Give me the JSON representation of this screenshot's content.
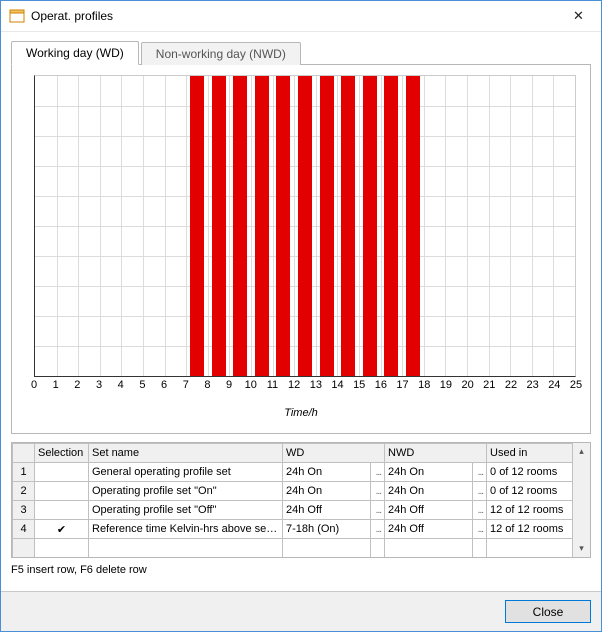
{
  "window": {
    "title": "Operat. profiles",
    "close_glyph": "✕"
  },
  "tabs": {
    "wd": "Working day (WD)",
    "nwd": "Non-working day (NWD)"
  },
  "chart_data": {
    "type": "bar",
    "title": "",
    "xlabel": "Time/h",
    "ylabel": "",
    "xlim": [
      0,
      25
    ],
    "ylim": [
      0,
      1
    ],
    "ticks": [
      0,
      1,
      2,
      3,
      4,
      5,
      6,
      7,
      8,
      9,
      10,
      11,
      12,
      13,
      14,
      15,
      16,
      17,
      18,
      19,
      20,
      21,
      22,
      23,
      24,
      25
    ],
    "categories": [
      0,
      1,
      2,
      3,
      4,
      5,
      6,
      7,
      8,
      9,
      10,
      11,
      12,
      13,
      14,
      15,
      16,
      17,
      18,
      19,
      20,
      21,
      22,
      23,
      24
    ],
    "values": [
      0,
      0,
      0,
      0,
      0,
      0,
      0,
      1,
      1,
      1,
      1,
      1,
      1,
      1,
      1,
      1,
      1,
      1,
      0,
      0,
      0,
      0,
      0,
      0,
      0
    ]
  },
  "table": {
    "headers": {
      "selection": "Selection",
      "set_name": "Set name",
      "wd": "WD",
      "nwd": "NWD",
      "used_in": "Used in"
    },
    "rows": [
      {
        "n": "1",
        "sel": "",
        "name": "General operating profile set",
        "wd": "24h On",
        "nwd": "24h On",
        "used": "0 of 12 rooms"
      },
      {
        "n": "2",
        "sel": "",
        "name": "Operating profile set \"On\"",
        "wd": "24h On",
        "nwd": "24h On",
        "used": "0 of 12 rooms"
      },
      {
        "n": "3",
        "sel": "",
        "name": "Operating profile set \"Off\"",
        "wd": "24h Off",
        "nwd": "24h Off",
        "used": "12 of 12 rooms"
      },
      {
        "n": "4",
        "sel": "✔",
        "name": "Reference time Kelvin-hrs above set p...",
        "wd": "7-18h (On)",
        "nwd": "24h Off",
        "used": "12 of 12 rooms"
      }
    ],
    "dots": "..."
  },
  "status_hint": "F5 insert row, F6 delete row",
  "footer": {
    "close": "Close"
  }
}
